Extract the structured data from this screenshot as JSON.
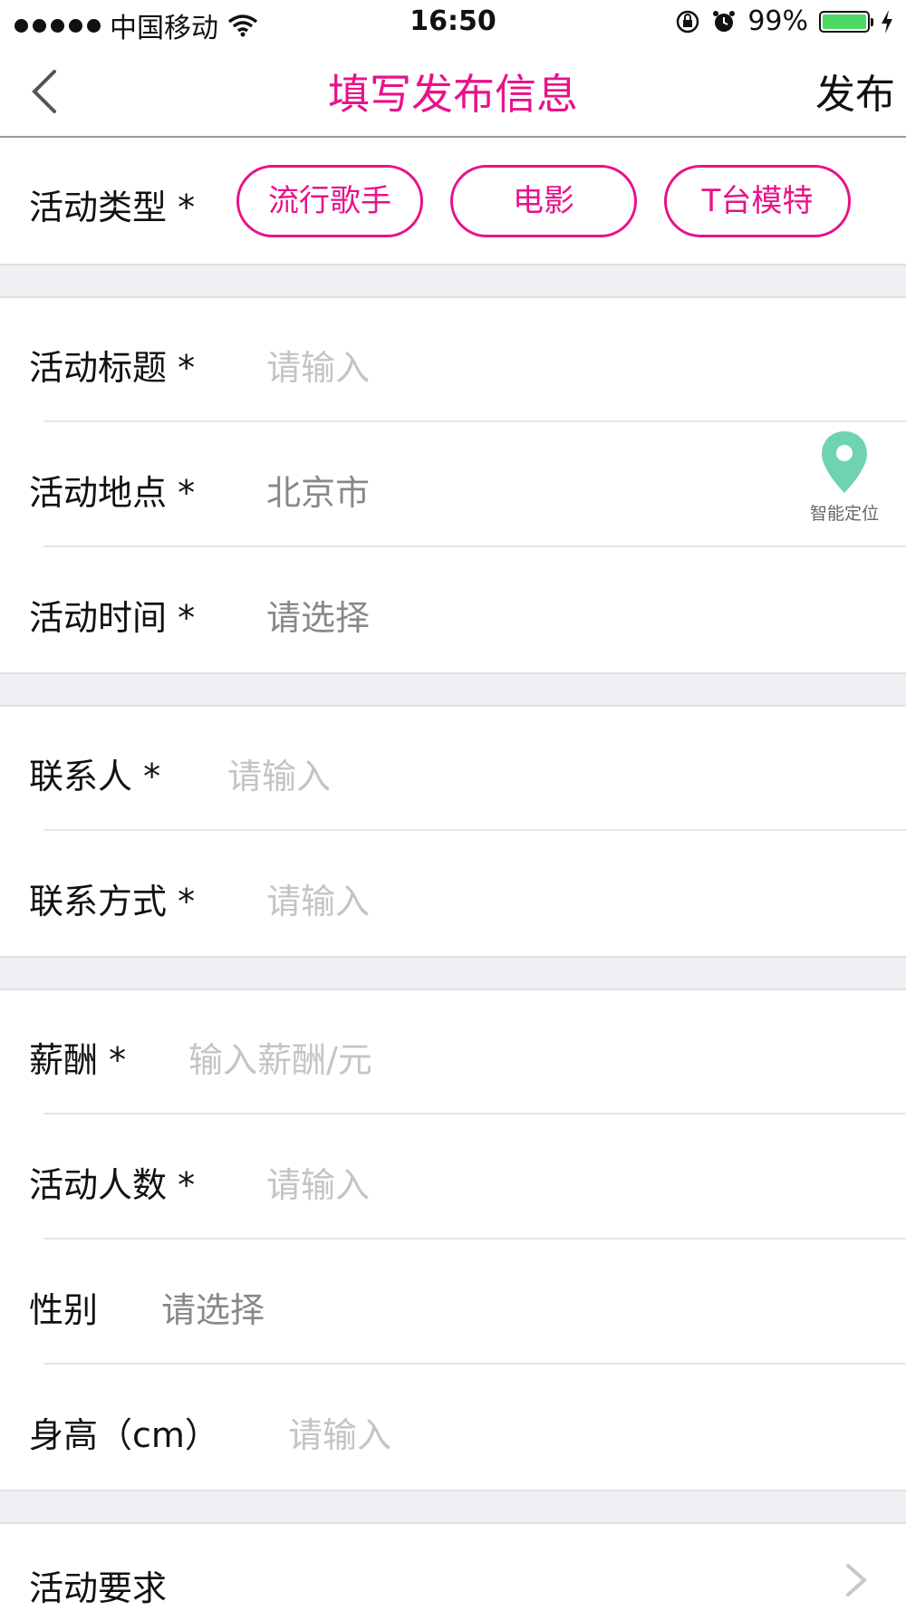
{
  "status_bar": {
    "carrier": "中国移动",
    "time": "16:50",
    "battery": "99%",
    "battery_level": 0.99,
    "icons": [
      "signal-dots-icon",
      "wifi-icon",
      "orientation-lock-icon",
      "alarm-icon",
      "battery-icon",
      "charging-icon"
    ]
  },
  "nav": {
    "title": "填写发布信息",
    "publish_label": "发布",
    "back_icon": "chevron-left-icon"
  },
  "colors": {
    "accent": "#e8128b",
    "placeholder": "#c4c4c8",
    "location_pin": "#6fd3b0",
    "section_gap": "#efeff4"
  },
  "activity_type": {
    "label": "活动类型 *",
    "options": [
      "流行歌手",
      "电影",
      "T台模特"
    ]
  },
  "fields": {
    "title": {
      "label": "活动标题 *",
      "placeholder": "请输入"
    },
    "location": {
      "label": "活动地点 *",
      "value": "北京市",
      "locate_label": "智能定位"
    },
    "time": {
      "label": "活动时间 *",
      "value": "请选择"
    },
    "contact": {
      "label": "联系人 *",
      "placeholder": "请输入"
    },
    "contact_method": {
      "label": "联系方式 *",
      "placeholder": "请输入"
    },
    "salary": {
      "label": "薪酬 *",
      "placeholder": "输入薪酬/元"
    },
    "headcount": {
      "label": "活动人数 *",
      "placeholder": "请输入"
    },
    "gender": {
      "label": "性别",
      "value": "请选择"
    },
    "height": {
      "label": "身高（cm）",
      "placeholder": "请输入"
    },
    "requirements": {
      "label": "活动要求"
    }
  }
}
